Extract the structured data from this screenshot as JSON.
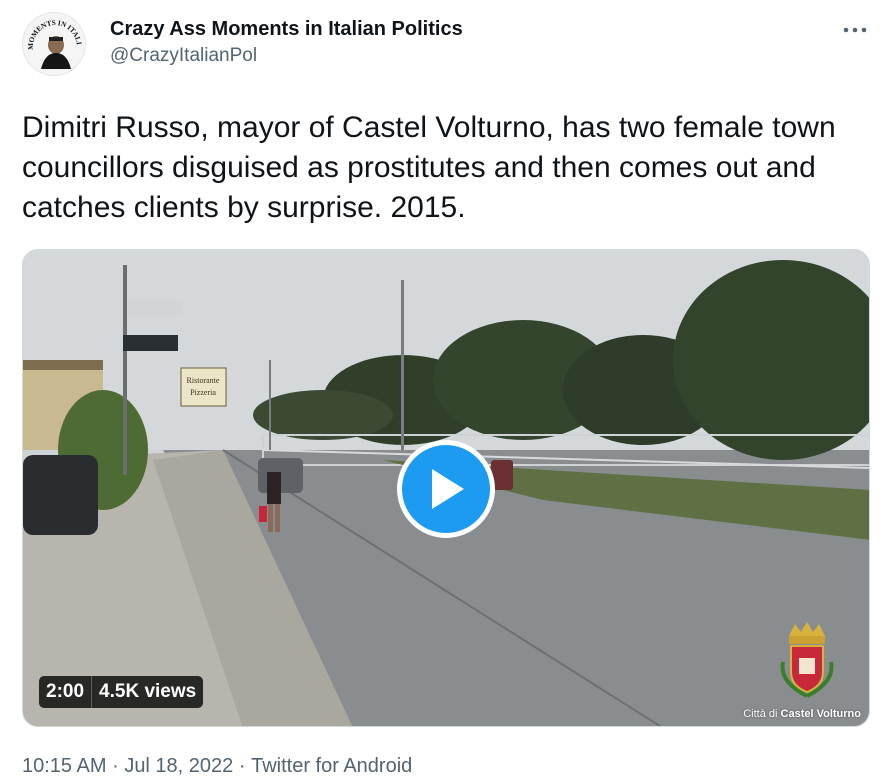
{
  "author": {
    "display_name": "Crazy Ass Moments in Italian Politics",
    "handle": "@CrazyItalianPol",
    "avatar_text": "CRAZY ASS MOMENTS IN ITALIAN POLITICS"
  },
  "tweet": {
    "text": "Dimitri Russo, mayor of Castel Volturno, has two female town councillors disguised as prostitutes and then comes out and catches clients by surprise. 2015."
  },
  "video": {
    "duration": "2:00",
    "views": "4.5K views",
    "watermark_prefix": "Città di",
    "watermark_name": "Castel Volturno",
    "sign_texts": [
      "Ristorante",
      "Pizzeria"
    ]
  },
  "meta": {
    "time": "10:15 AM",
    "sep1": "·",
    "date": "Jul 18, 2022",
    "sep2": "·",
    "source": "Twitter for Android"
  },
  "colors": {
    "accent": "#1d9bf0",
    "text_primary": "#0f1419",
    "text_secondary": "#536471"
  },
  "icons": {
    "more": "more-icon",
    "play": "play-icon"
  }
}
